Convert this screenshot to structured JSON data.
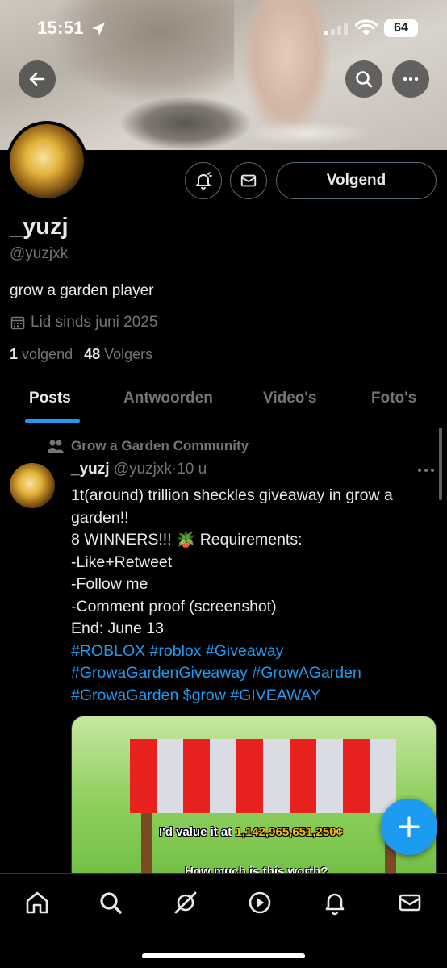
{
  "status_bar": {
    "time": "15:51",
    "battery": "64"
  },
  "profile": {
    "name": "_yuzj",
    "handle": "@yuzjxk",
    "bio": "grow a garden player",
    "joined": "Lid sinds juni 2025",
    "following_count": "1",
    "following_label": "volgend",
    "followers_count": "48",
    "followers_label": "Volgers",
    "follow_button": "Volgend"
  },
  "tabs": [
    {
      "label": "Posts",
      "active": true
    },
    {
      "label": "Antwoorden",
      "active": false
    },
    {
      "label": "Video's",
      "active": false
    },
    {
      "label": "Foto's",
      "active": false
    }
  ],
  "post": {
    "community": "Grow a Garden Community",
    "author_name": "_yuzj",
    "author_handle": "@yuzjxk",
    "separator": "·",
    "time": "10 u",
    "lines": [
      "1t(around) trillion sheckles giveaway in grow a",
      "garden!!",
      " 8 WINNERS!!! 🪴 Requirements:",
      "-Like+Retweet",
      "-Follow me",
      "-Comment proof (screenshot)",
      " End: June 13"
    ],
    "hashtag_lines": [
      "#ROBLOX #roblox #Giveaway",
      "#GrowaGardenGiveaway #GrowAGarden",
      "#GrowaGarden $grow #GIVEAWAY"
    ],
    "media": {
      "caption_prefix": "I'd value it at ",
      "caption_amount": "1,142,965,651,250¢",
      "caption_2": "How much is this worth?"
    }
  },
  "colors": {
    "accent": "#1d9bf0",
    "muted": "#71767b",
    "text": "#e7e9ea",
    "border": "#2f3336"
  },
  "icons": [
    "back-arrow-icon",
    "search-icon",
    "more-icon",
    "notification-bell-icon",
    "mail-icon",
    "community-icon",
    "home-icon",
    "grok-icon",
    "video-icon",
    "bell-icon",
    "plus-icon",
    "calendar-icon"
  ]
}
